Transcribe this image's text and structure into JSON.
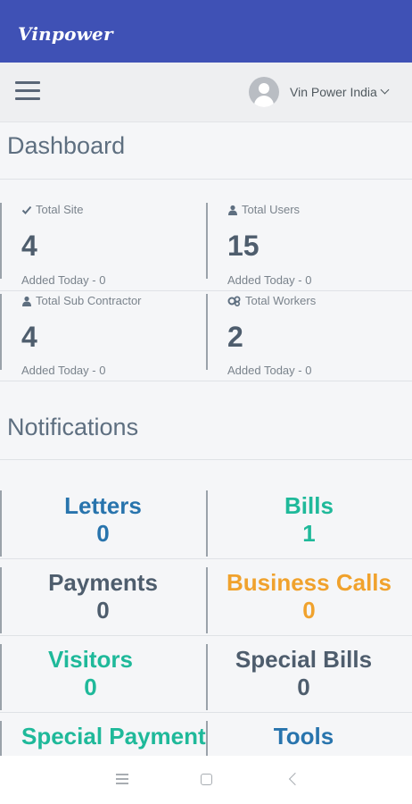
{
  "app": {
    "title": "Vinpower"
  },
  "header": {
    "menu_icon": "hamburger-menu-icon",
    "user_name": "Vin Power India",
    "avatar_icon": "user-avatar-icon",
    "caret_icon": "chevron-down-icon"
  },
  "dashboard": {
    "title": "Dashboard",
    "stats": [
      {
        "label": "Total Site",
        "icon": "check-icon",
        "value": "4",
        "added": "Added Today - 0"
      },
      {
        "label": "Total Users",
        "icon": "user-icon",
        "value": "15",
        "added": "Added Today - 0"
      },
      {
        "label": "Total Sub Contractor",
        "icon": "user-icon",
        "value": "4",
        "added": "Added Today - 0"
      },
      {
        "label": "Total Workers",
        "icon": "workers-icon",
        "value": "2",
        "added": "Added Today - 0"
      }
    ]
  },
  "notifications": {
    "title": "Notifications",
    "items": [
      {
        "label": "Letters",
        "count": "0",
        "color": "#2874ad"
      },
      {
        "label": "Bills",
        "count": "1",
        "color": "#1fb99a"
      },
      {
        "label": "Payments",
        "count": "0",
        "color": "#4e5d6d"
      },
      {
        "label": "Business Calls",
        "count": "0",
        "color": "#f0a22d"
      },
      {
        "label": "Visitors",
        "count": "0",
        "color": "#1fb99a"
      },
      {
        "label": "Special Bills",
        "count": "0",
        "color": "#4e5d6d"
      },
      {
        "label": "Special Payment",
        "count": "",
        "color": "#1fb99a"
      },
      {
        "label": "Tools",
        "count": "",
        "color": "#2874ad"
      }
    ]
  },
  "system_nav": {
    "menu_icon": "recent-apps-icon",
    "home_icon": "home-icon",
    "back_icon": "back-icon"
  },
  "colors": {
    "appbar": "#3f51b5",
    "topbar": "#eeeff1",
    "text_muted": "#7a838c",
    "text_dark": "#4e5d6d"
  }
}
